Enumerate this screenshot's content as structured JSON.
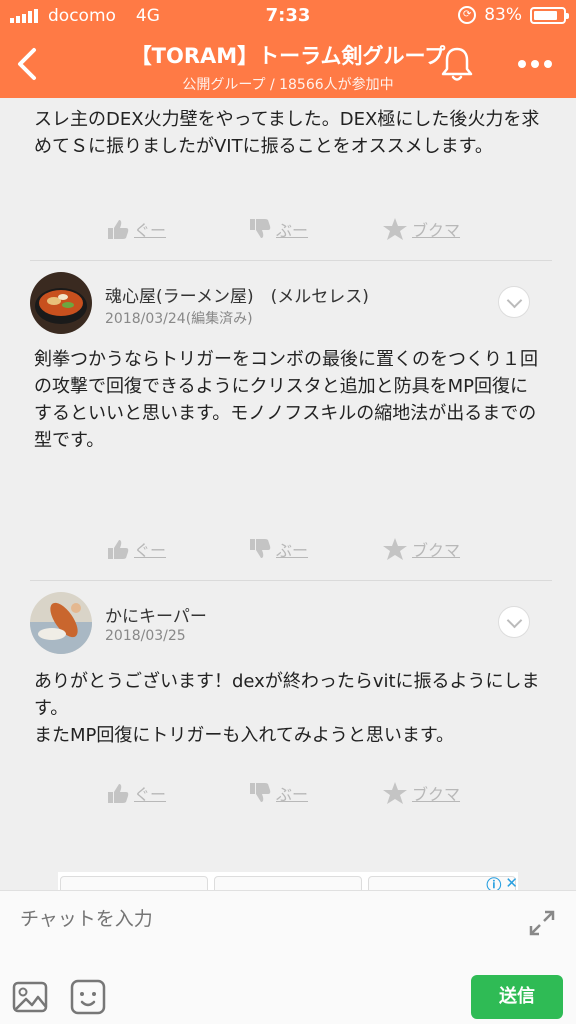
{
  "status_bar": {
    "carrier": "docomo",
    "network": "4G",
    "time": "7:33",
    "battery": "83%",
    "battery_level": 0.83
  },
  "header": {
    "title": "【TORAM】トーラム剣グループ",
    "subtitle": "公開グループ / 18566人が参加中"
  },
  "colors": {
    "header_bg": "#ff7a45",
    "send_button": "#2fbb55",
    "page_bg": "#efefef"
  },
  "actions": {
    "good": "ぐー",
    "bad": "ぶー",
    "bookmark": "ブクマ"
  },
  "posts": [
    {
      "body": "スレ主のDEX火力壁をやってました。DEX極にした後火力を求めてＳに振りましたがVITに振ることをオススメします。"
    },
    {
      "name": "魂心屋(ラーメン屋)　(メルセレス)",
      "date": "2018/03/24(編集済み)",
      "body": "剣拳つかうならトリガーをコンボの最後に置くのをつくり１回の攻撃で回復できるようにクリスタと追加と防具をMP回復にするといいと思います。モノノフスキルの縮地法が出るまでの型です。"
    },
    {
      "name": "かにキーパー",
      "date": "2018/03/25",
      "body_lines": [
        "ありがとうございます！dexが終わったらvitに振るようにします。",
        "またMP回復にトリガーも入れてみようと思います。"
      ]
    }
  ],
  "composer": {
    "placeholder": "チャットを入力",
    "send_label": "送信"
  }
}
